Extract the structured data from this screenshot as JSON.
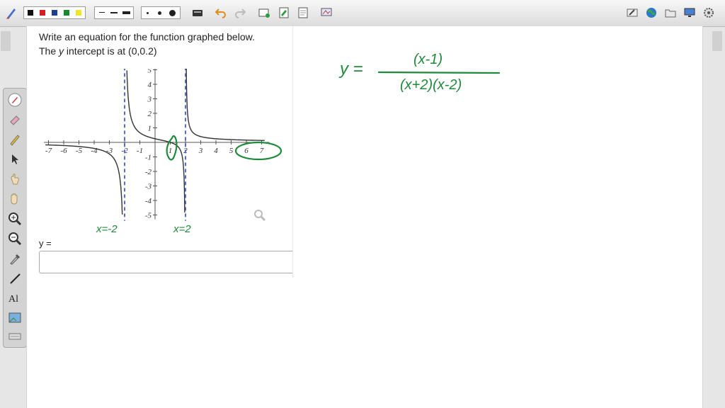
{
  "toolbar": {
    "pen_colors": [
      "#111111",
      "#d81f1f",
      "#1d3f8f",
      "#1b8a2c",
      "#f3e32a"
    ],
    "left_icons": [
      "pen-tool-icon"
    ],
    "right_icons": [
      "write-icon",
      "globe-icon",
      "folder-icon",
      "monitor-icon",
      "settings-icon"
    ]
  },
  "question": {
    "line1": "Write an equation for the function graphed below.",
    "line2_prefix": "The ",
    "line2_var": "y",
    "line2_suffix": " intercept is at (0,0.2)",
    "answer_label": "y =",
    "answer_value": ""
  },
  "graph": {
    "x_ticks": [
      "-7",
      "-6",
      "-5",
      "-4",
      "-3",
      "-2",
      "-1",
      "1",
      "2",
      "3",
      "4",
      "5",
      "6",
      "7"
    ],
    "y_ticks": [
      "5",
      "4",
      "3",
      "2",
      "1",
      "-1",
      "-2",
      "-3",
      "-4",
      "-5"
    ],
    "asymptote_color": "#5a6bd6",
    "curve_color": "#333333"
  },
  "handwriting": {
    "color": "#1e8a3a",
    "asymptote_left": "x=-2",
    "asymptote_right": "x=2",
    "equation_lhs": "y =",
    "numerator": "(x-1)",
    "denominator": "(x+2)(x-2)"
  }
}
